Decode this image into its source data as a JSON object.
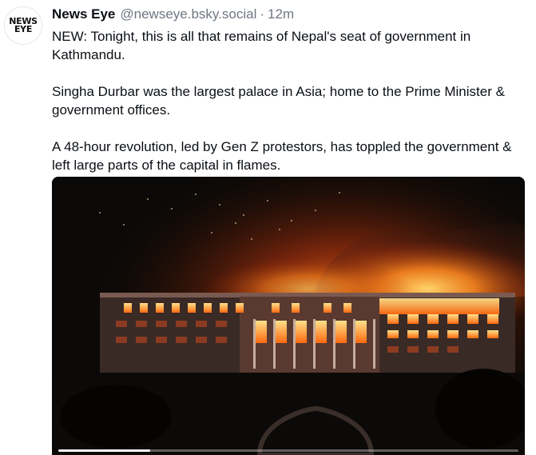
{
  "post": {
    "author": {
      "name": "News Eye",
      "handle": "@newseye.bsky.social",
      "avatar_line1": "NEWS",
      "avatar_line2": "EYE"
    },
    "separator": "·",
    "time": "12m",
    "paragraphs": [
      "NEW: Tonight, this is all that remains of Nepal's seat of government in Kathmandu.",
      "Singha Durbar was the largest palace in Asia; home to the Prime Minister & government offices.",
      "A 48-hour revolution, led by Gen Z protestors, has toppled the government & left large parts of the capital in flames."
    ],
    "media": {
      "type": "video",
      "progress": 0.2
    }
  }
}
